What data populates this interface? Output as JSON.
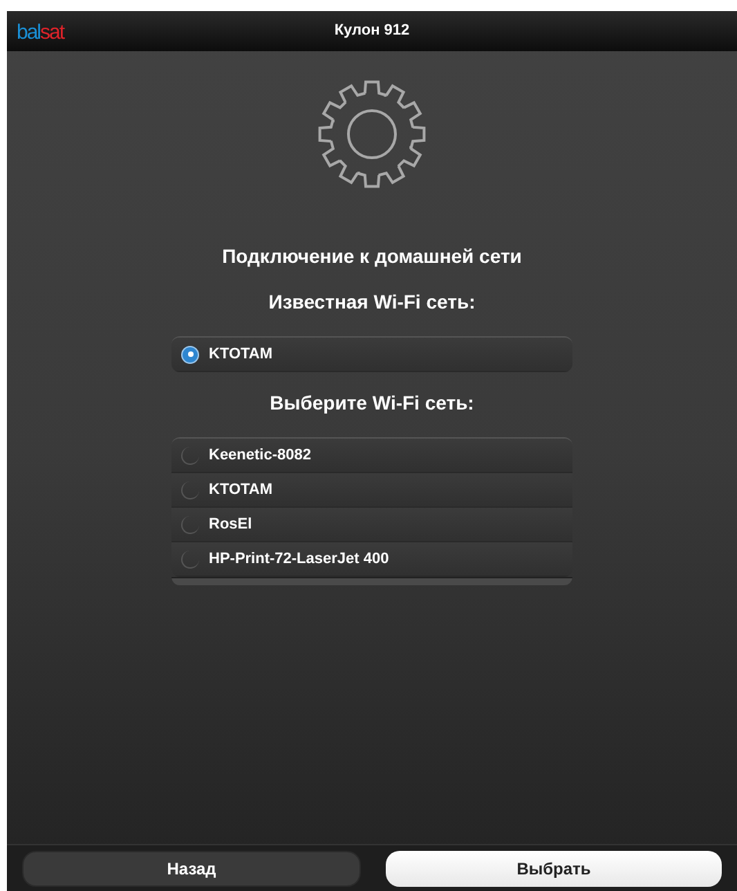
{
  "header": {
    "logo": [
      {
        "text": "bal",
        "color": "#1a8fd6"
      },
      {
        "text": "sat",
        "color": "#e0232a"
      }
    ],
    "title": "Кулон 912"
  },
  "heading": "Подключение к домашней сети",
  "known_network": {
    "title": "Известная Wi-Fi сеть:",
    "items": [
      {
        "label": "KTOTAM",
        "selected": true
      }
    ]
  },
  "networks": {
    "title": "Выберите Wi-Fi сеть:",
    "items": [
      {
        "label": "Keenetic-8082",
        "selected": false
      },
      {
        "label": "KTOTAM",
        "selected": false
      },
      {
        "label": "RosEl",
        "selected": false
      },
      {
        "label": "HP-Print-72-LaserJet 400",
        "selected": false
      }
    ]
  },
  "buttons": [
    {
      "label": "Назад",
      "kind": "secondary"
    },
    {
      "label": "Выбрать",
      "kind": "primary"
    }
  ]
}
